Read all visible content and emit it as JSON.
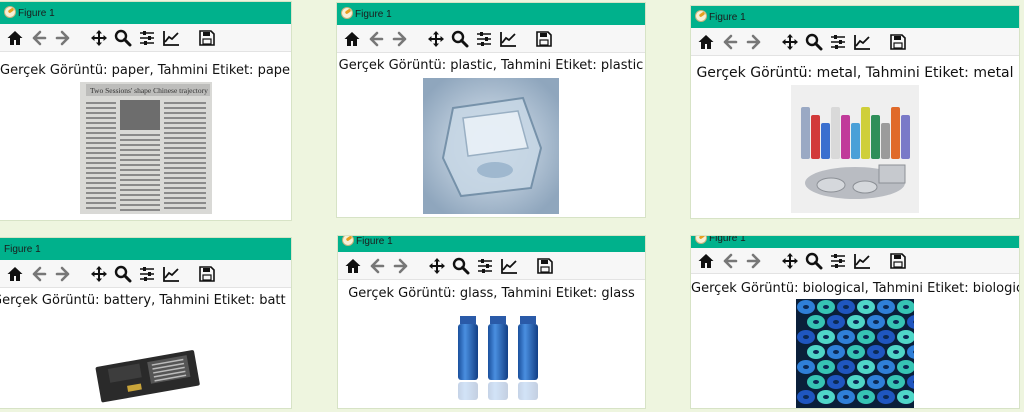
{
  "windows": [
    {
      "title": "Figure 1",
      "caption": "Gerçek Görüntü: paper, Tahmini Etiket: paper",
      "image": "newspaper-photo"
    },
    {
      "title": "Figure 1",
      "caption": "Gerçek Görüntü: plastic, Tahmini Etiket: plastic",
      "image": "plastic-container-photo"
    },
    {
      "title": "Figure 1",
      "caption": "Gerçek Görüntü: metal, Tahmini Etiket: metal",
      "image": "metal-cans-photo"
    },
    {
      "title": "Figure 1",
      "caption": "Gerçek Görüntü: battery, Tahmini Etiket: batt",
      "image": "battery-photo"
    },
    {
      "title": "Figure 1",
      "caption": "Gerçek Görüntü: glass, Tahmini Etiket: glass",
      "image": "glass-bottles-photo"
    },
    {
      "title": "Figure 1",
      "caption": "Gerçek Görüntü: biological, Tahmini Etiket: biological",
      "image": "biological-photo"
    }
  ],
  "toolbar_icons": [
    "home-icon",
    "back-icon",
    "forward-icon",
    "pan-icon",
    "zoom-icon",
    "configure-subplots-icon",
    "edit-axis-icon",
    "save-icon"
  ],
  "colors": {
    "titlebar": "#00b18c",
    "background": "#eef5df"
  }
}
